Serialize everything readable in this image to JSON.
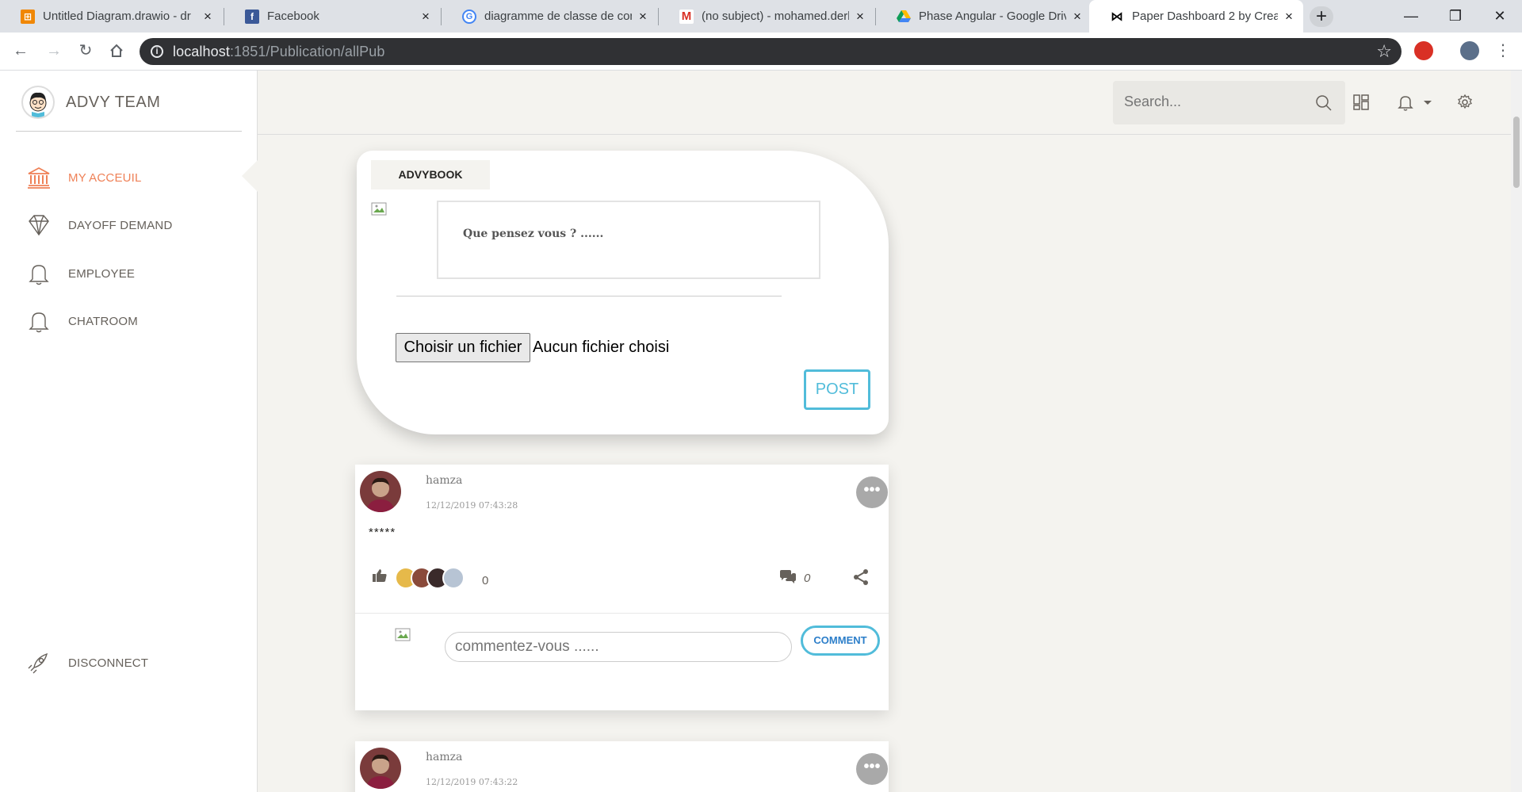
{
  "browser": {
    "tabs": [
      {
        "title": "Untitled Diagram.drawio - dr",
        "icon": "drawio-icon",
        "color": "#f08705"
      },
      {
        "title": "Facebook",
        "icon": "facebook-icon",
        "color": "#3b5998"
      },
      {
        "title": "diagramme de classe de con",
        "icon": "google-icon",
        "color": "#4285f4"
      },
      {
        "title": "(no subject) - mohamed.derb",
        "icon": "gmail-icon",
        "color": "#d93025"
      },
      {
        "title": "Phase Angular - Google Driv",
        "icon": "google-drive-icon",
        "color": "#0f9d58"
      },
      {
        "title": "Paper Dashboard 2 by Creati",
        "icon": "creative-tim-icon",
        "color": "#000000"
      }
    ],
    "url_host": "localhost",
    "url_path": ":1851/Publication/allPub"
  },
  "sidebar": {
    "brand": "ADVY TEAM",
    "items": [
      {
        "label": "MY ACCEUIL",
        "icon": "bank-icon",
        "active": true
      },
      {
        "label": "DAYOFF DEMAND",
        "icon": "diamond-icon",
        "active": false
      },
      {
        "label": "EMPLOYEE",
        "icon": "bell-icon",
        "active": false
      },
      {
        "label": "CHATROOM",
        "icon": "bell-icon",
        "active": false
      }
    ],
    "disconnect": "DISCONNECT",
    "accent": "#ef8157"
  },
  "topnav": {
    "search_placeholder": "Search..."
  },
  "composer": {
    "tab_label": "ADVYBOOK",
    "placeholder": "Que pensez vous ? ......",
    "file_button": "Choisir un fichier",
    "file_status": "Aucun fichier choisi",
    "post_button": "POST"
  },
  "feed": [
    {
      "author": "hamza",
      "timestamp": "12/12/2019 07:43:28",
      "body": "*****",
      "like_count": "0",
      "comment_count": "0",
      "comment_placeholder": "commentez-vous ......",
      "comment_button": "COMMENT"
    },
    {
      "author": "hamza",
      "timestamp": "12/12/2019 07:43:22"
    }
  ],
  "colors": {
    "info": "#51bcda",
    "background": "#f4f3ef"
  }
}
